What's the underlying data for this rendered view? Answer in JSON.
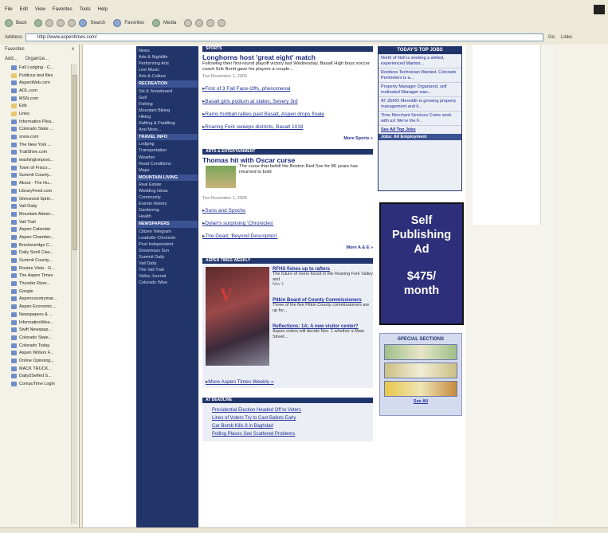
{
  "browser": {
    "menu": [
      "File",
      "Edit",
      "View",
      "Favorites",
      "Tools",
      "Help"
    ],
    "toolbar": {
      "back": "Back",
      "search": "Search",
      "favorites": "Favorites",
      "media": "Media"
    },
    "address_label": "Address",
    "url": "http://www.aspentimes.com/",
    "go": "Go",
    "links": "Links"
  },
  "favorites": {
    "title": "Favorites",
    "close": "x",
    "add": "Add...",
    "organize": "Organize...",
    "items": [
      {
        "label": "Fall Lodging - C...",
        "folder": false
      },
      {
        "label": "Publicus test files",
        "folder": true
      },
      {
        "label": "AspenWeb.com",
        "folder": false
      },
      {
        "label": "AOL.com",
        "folder": false
      },
      {
        "label": "MSN.com",
        "folder": false
      },
      {
        "label": "Edit",
        "folder": true
      },
      {
        "label": "Links",
        "folder": true
      },
      {
        "label": "Information Plea...",
        "folder": false
      },
      {
        "label": "Colorado State ...",
        "folder": false
      },
      {
        "label": "snow.com",
        "folder": false
      },
      {
        "label": "The New York ...",
        "folder": false
      },
      {
        "label": "TrailShire.com",
        "folder": false
      },
      {
        "label": "washingtonpost...",
        "folder": false
      },
      {
        "label": "Town of Frisco...",
        "folder": false
      },
      {
        "label": "Summit County...",
        "folder": false
      },
      {
        "label": "About - The Hu...",
        "folder": false
      },
      {
        "label": "LibraryFeed.com",
        "folder": false
      },
      {
        "label": "Glenwood Sprin...",
        "folder": false
      },
      {
        "label": "Vail Daily",
        "folder": false
      },
      {
        "label": "Mountain Adven...",
        "folder": false
      },
      {
        "label": "Vail Trail",
        "folder": false
      },
      {
        "label": "Aspen Calendar",
        "folder": false
      },
      {
        "label": "Aspen Chamber...",
        "folder": false
      },
      {
        "label": "Breckenridge C...",
        "folder": false
      },
      {
        "label": "Daily Snell Clas...",
        "folder": false
      },
      {
        "label": "Summit County...",
        "folder": false
      },
      {
        "label": "Routes Vista - G...",
        "folder": false
      },
      {
        "label": "The Aspen Times",
        "folder": false
      },
      {
        "label": "Thunder River...",
        "folder": false
      },
      {
        "label": "Google",
        "folder": false
      },
      {
        "label": "Aspencountrymar...",
        "folder": false
      },
      {
        "label": "Aspen Economic...",
        "folder": false
      },
      {
        "label": "Newspapers & ...",
        "folder": false
      },
      {
        "label": "InformationWee...",
        "folder": false
      },
      {
        "label": "Swift Newspap...",
        "folder": false
      },
      {
        "label": "Colorado State...",
        "folder": false
      },
      {
        "label": "Colorado Today",
        "folder": false
      },
      {
        "label": "Aspen Writers F...",
        "folder": false
      },
      {
        "label": "Online Opinolog...",
        "folder": false
      },
      {
        "label": "MACK TRUCK...",
        "folder": false
      },
      {
        "label": "Daily2Selfed S...",
        "folder": false
      },
      {
        "label": "CompuTime Login",
        "folder": false
      }
    ]
  },
  "nav": [
    {
      "t": "item",
      "label": "News"
    },
    {
      "t": "item",
      "label": "Arts & Nightlife"
    },
    {
      "t": "item",
      "label": "Performing Arts"
    },
    {
      "t": "item",
      "label": "Live Music"
    },
    {
      "t": "item",
      "label": "Arts & Culture"
    },
    {
      "t": "head",
      "label": "RECREATION"
    },
    {
      "t": "item",
      "label": "Ski & Snowboard"
    },
    {
      "t": "item",
      "label": "Golf"
    },
    {
      "t": "item",
      "label": "Fishing"
    },
    {
      "t": "item",
      "label": "Mountain Biking"
    },
    {
      "t": "item",
      "label": "Hiking"
    },
    {
      "t": "item",
      "label": "Rafting & Paddling"
    },
    {
      "t": "item",
      "label": "And More..."
    },
    {
      "t": "head",
      "label": "TRAVEL INFO"
    },
    {
      "t": "item",
      "label": "Lodging"
    },
    {
      "t": "item",
      "label": "Transportation"
    },
    {
      "t": "item",
      "label": "Weather"
    },
    {
      "t": "item",
      "label": "Road Conditions"
    },
    {
      "t": "item",
      "label": "Maps"
    },
    {
      "t": "head",
      "label": "MOUNTAIN LIVING"
    },
    {
      "t": "item",
      "label": "Real Estate"
    },
    {
      "t": "item",
      "label": "Wedding Ideas"
    },
    {
      "t": "item",
      "label": "Community"
    },
    {
      "t": "item",
      "label": "Events History"
    },
    {
      "t": "item",
      "label": "Gardening"
    },
    {
      "t": "item",
      "label": "Health"
    },
    {
      "t": "head",
      "label": "NEWSPAPERS"
    },
    {
      "t": "item",
      "label": "Citizen Telegram"
    },
    {
      "t": "item",
      "label": "Leadville Chronicle"
    },
    {
      "t": "item",
      "label": "Post Independent"
    },
    {
      "t": "item",
      "label": "Snowmass Sun"
    },
    {
      "t": "item",
      "label": "Summit Daily"
    },
    {
      "t": "item",
      "label": "Vail Daily"
    },
    {
      "t": "item",
      "label": "The Vail Trail"
    },
    {
      "t": "item",
      "label": "Valley Journal"
    },
    {
      "t": "item",
      "label": "Colorado Wise"
    }
  ],
  "sports": {
    "bar": "SPORTS",
    "headline": "Longhorns host 'great eight' match",
    "teaser": "Following their first-round playoff victory last Wednesday, Basalt High boys soccer coach Erik Bentt gave his players a couple...",
    "date": "Tue November 1, 2005",
    "links": [
      "First of 3 Fall Face-Offs, phenomenal",
      "Basalt girls podium at states; Severy 3rd",
      "Rams football rallies past Basalt, Aspen drops finale",
      "Roaring Fork sweeps districts, Basalt 1018"
    ],
    "more": "More Sports »"
  },
  "arts": {
    "bar": "ARTS & ENTERTAINMENT",
    "headline": "Thomas hit with Oscar curse",
    "teaser": "The curse that befell the Boston Red Sox for 86 years has returned to bold",
    "date": "Tue November 1, 2005",
    "links": [
      "Suns and Spochs",
      "Dylan's surprising 'Chronicles'",
      "The Dead, 'Beyond Description'"
    ],
    "more": "More A & E »"
  },
  "magazine": {
    "bar": "ASPEN TIMES WEEKLY",
    "logo": "V",
    "stories": [
      {
        "h": "RFHS fishes up to rafters",
        "t": "The future of rivers found in the Roaring Fork Valley and",
        "d": "Nov 1"
      },
      {
        "h": "Pitkin Board of County Commissioners",
        "t": "Three of the five Pitkin County commissioners are up for...",
        "d": ""
      },
      {
        "h": "Reflections: 1A; A new visitor center?",
        "t": "Aspen voters will decide Nov. 1 whether a Main Street...",
        "d": ""
      }
    ],
    "more": "More Aspen Times Weekly »"
  },
  "bottom": {
    "bar": "AT DEADLINE",
    "links": [
      "Presidential Election Headed Off to Voters",
      "Lines of Voters Try to Cast Ballots Early",
      "Car Bomb Kills 8 in Baghdad",
      "Polling Places See Scattered Problems"
    ]
  },
  "jobs": {
    "bar": "TODAY'S TOP JOBS",
    "items": [
      "North of Nell is seeking a skilled, experienced Manitor...",
      "Rootless Technician Wanted. Colorado Perimeters is a...",
      "Property Manager Organized, self motivated Manager wan...",
      "AT ZERO Meredith is growing property management and it...",
      "Time Merchant Services Come work with us! We're the F..."
    ],
    "see_all": "See All Top Jobs",
    "see_emp": "Jobs: All Employment"
  },
  "ad": {
    "line1": "Self",
    "line2": "Publishing",
    "line3": "Ad",
    "price": "$475/",
    "period": "month"
  },
  "special": {
    "title": "SPECIAL SECTIONS",
    "see_all": "See All"
  }
}
